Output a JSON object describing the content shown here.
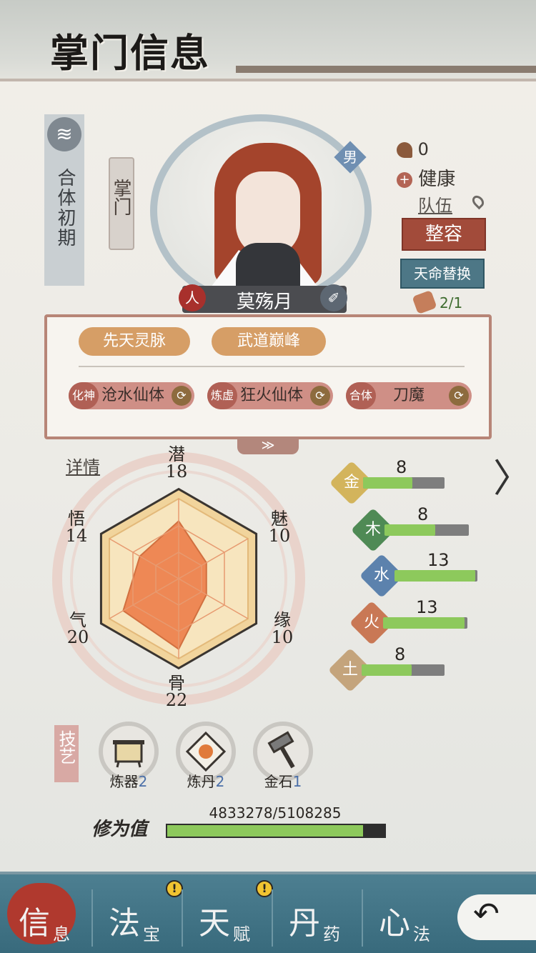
{
  "header": {
    "title": "掌门信息"
  },
  "realm": {
    "text": "合体初期",
    "icon": "cloud-icon"
  },
  "role": {
    "text": "掌门"
  },
  "character": {
    "name": "莫殇月",
    "gender": "男",
    "left_icon_text": "人",
    "right_icon_text": "✐"
  },
  "status": {
    "fame_value": "0",
    "health_text": "健康",
    "team_label": "队伍"
  },
  "buttons": {
    "face": "整容",
    "destiny": "天命替换"
  },
  "scroll": {
    "count": "2/1"
  },
  "traits": [
    "先天灵脉",
    "武道巅峰"
  ],
  "bodies": [
    {
      "prefix": "化神",
      "label": "沧水仙体"
    },
    {
      "prefix": "炼虚",
      "label": "狂火仙体"
    },
    {
      "prefix": "合体",
      "label": "刀魔"
    }
  ],
  "expand_icon": "≫",
  "detail_label": "详情",
  "attributes": [
    {
      "name": "潜",
      "value": 18
    },
    {
      "name": "魅",
      "value": 10
    },
    {
      "name": "缘",
      "value": 10
    },
    {
      "name": "骨",
      "value": 22
    },
    {
      "name": "气",
      "value": 20
    },
    {
      "name": "悟",
      "value": 14
    }
  ],
  "elements": [
    {
      "char": "金",
      "value": "8",
      "fill": 0.62,
      "color": "#d3b45c"
    },
    {
      "char": "木",
      "value": "8",
      "fill": 0.62,
      "color": "#4f8a55"
    },
    {
      "char": "水",
      "value": "13",
      "fill": 1.0,
      "color": "#5c82ad"
    },
    {
      "char": "火",
      "value": "13",
      "fill": 1.0,
      "color": "#c97855"
    },
    {
      "char": "土",
      "value": "8",
      "fill": 0.62,
      "color": "#c4a47c"
    }
  ],
  "skills_heading": "技艺",
  "skills": [
    {
      "name": "炼器",
      "level": "2",
      "icon": "cauldron-icon"
    },
    {
      "name": "炼丹",
      "level": "2",
      "icon": "pill-icon"
    },
    {
      "name": "金石",
      "level": "1",
      "icon": "hammer-icon"
    }
  ],
  "cultivation": {
    "label": "修为值",
    "current": 4833278,
    "max": 5108285,
    "text": "4833278/5108285"
  },
  "nav": [
    {
      "big": "信",
      "small": "息",
      "alert": false
    },
    {
      "big": "法",
      "small": "宝",
      "alert": true
    },
    {
      "big": "天",
      "small": "赋",
      "alert": true
    },
    {
      "big": "丹",
      "small": "药",
      "alert": false
    },
    {
      "big": "心",
      "small": "法",
      "alert": false
    }
  ],
  "alert_mark": "!",
  "back_icon": "↶",
  "arrow_icon": "〉",
  "colors": {
    "accent": "#a24b3a",
    "nav": "#4d7f91",
    "progress": "#8dc95c"
  }
}
